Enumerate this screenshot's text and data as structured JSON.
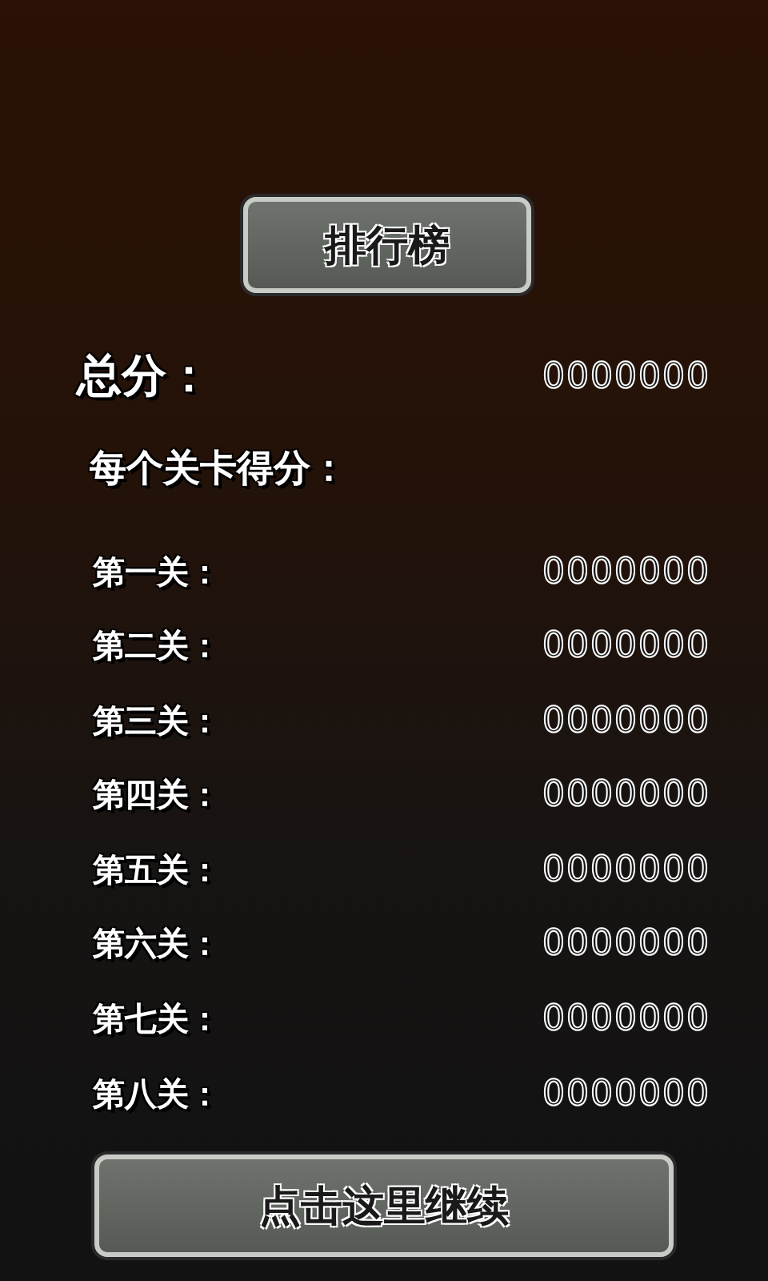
{
  "title_button": {
    "label": "排行榜"
  },
  "total": {
    "label": "总分：",
    "value": "0000000"
  },
  "section_heading": "每个关卡得分：",
  "levels": [
    {
      "label": "第一关：",
      "score": "0000000"
    },
    {
      "label": "第二关：",
      "score": "0000000"
    },
    {
      "label": "第三关：",
      "score": "0000000"
    },
    {
      "label": "第四关：",
      "score": "0000000"
    },
    {
      "label": "第五关：",
      "score": "0000000"
    },
    {
      "label": "第六关：",
      "score": "0000000"
    },
    {
      "label": "第七关：",
      "score": "0000000"
    },
    {
      "label": "第八关：",
      "score": "0000000"
    }
  ],
  "continue_button": {
    "label": "点击这里继续"
  }
}
